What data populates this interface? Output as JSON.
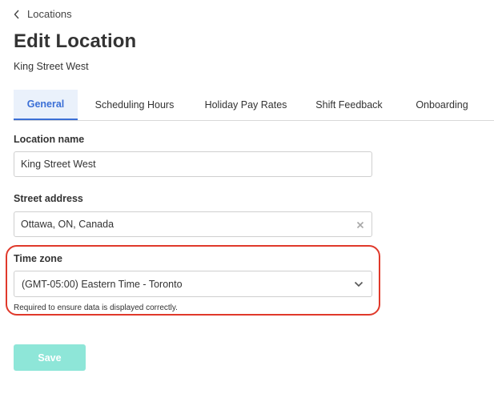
{
  "nav": {
    "back_label": "Locations",
    "back_icon": "chevron-left-icon"
  },
  "header": {
    "title": "Edit Location",
    "subtitle": "King Street West"
  },
  "tabs": [
    {
      "label": "General",
      "active": true
    },
    {
      "label": "Scheduling Hours",
      "active": false
    },
    {
      "label": "Holiday Pay Rates",
      "active": false
    },
    {
      "label": "Shift Feedback",
      "active": false
    },
    {
      "label": "Onboarding",
      "active": false
    }
  ],
  "form": {
    "location_name": {
      "label": "Location name",
      "value": "King Street West"
    },
    "street_address": {
      "label": "Street address",
      "value": "Ottawa, ON, Canada",
      "clear_icon": "close-icon"
    },
    "time_zone": {
      "label": "Time zone",
      "selected": "(GMT-05:00) Eastern Time - Toronto",
      "help_text": "Required to ensure data is displayed correctly.",
      "dropdown_icon": "chevron-down-icon"
    },
    "save_label": "Save"
  },
  "colors": {
    "accent": "#3b6fd6",
    "tab_active_bg": "#eaf1fb",
    "save_button": "#8ee6d8",
    "highlight_border": "#e0392b"
  }
}
